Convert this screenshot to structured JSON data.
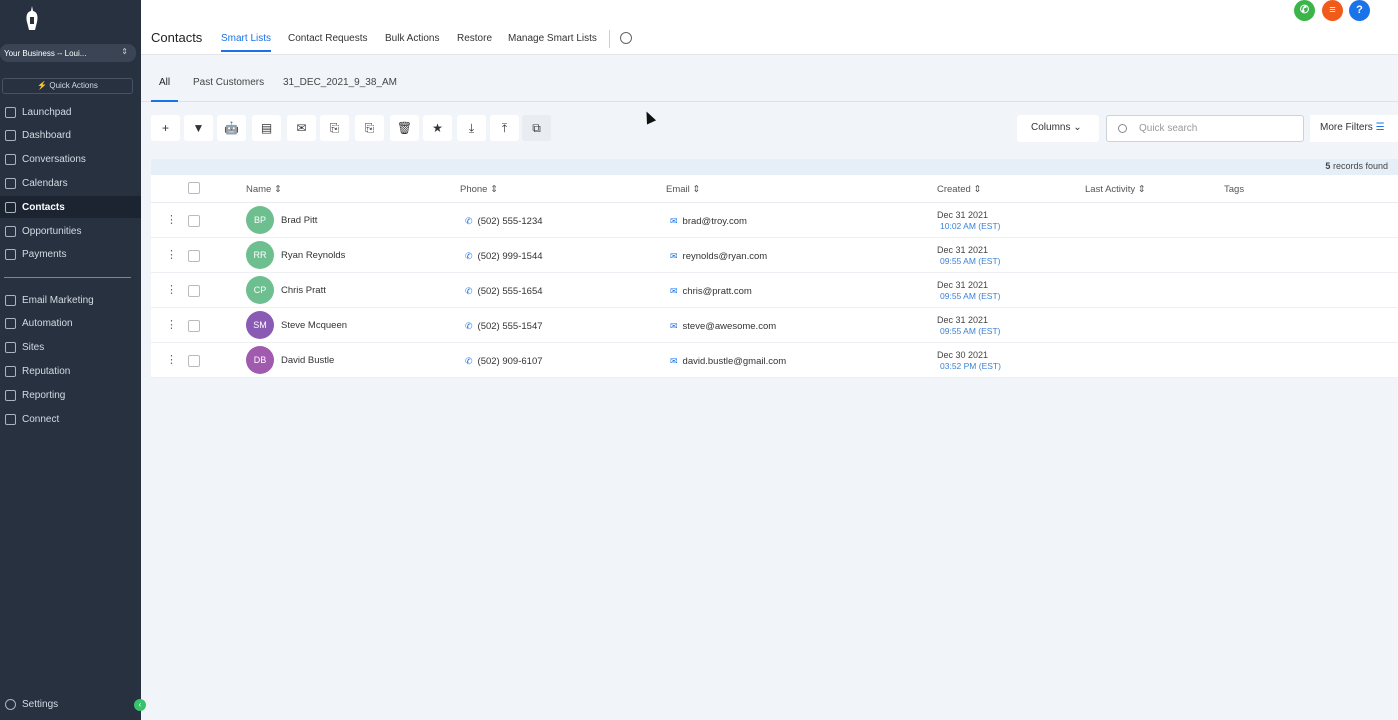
{
  "sidebar": {
    "business": "Your Business -- Loui...",
    "quick_actions": "Quick Actions",
    "items": [
      {
        "label": "Launchpad",
        "icon": "rocket-icon"
      },
      {
        "label": "Dashboard",
        "icon": "grid-icon"
      },
      {
        "label": "Conversations",
        "icon": "chat-icon"
      },
      {
        "label": "Calendars",
        "icon": "calendar-icon"
      },
      {
        "label": "Contacts",
        "icon": "contacts-icon",
        "active": true
      },
      {
        "label": "Opportunities",
        "icon": "funnel-icon"
      },
      {
        "label": "Payments",
        "icon": "payments-icon"
      }
    ],
    "items2": [
      {
        "label": "Email Marketing",
        "icon": "send-icon"
      },
      {
        "label": "Automation",
        "icon": "automation-icon"
      },
      {
        "label": "Sites",
        "icon": "sites-icon"
      },
      {
        "label": "Reputation",
        "icon": "star-icon"
      },
      {
        "label": "Reporting",
        "icon": "chart-icon"
      },
      {
        "label": "Connect",
        "icon": "facebook-icon"
      }
    ],
    "settings": "Settings"
  },
  "header": {
    "title": "Contacts",
    "tabs": [
      "Smart Lists",
      "Contact Requests",
      "Bulk Actions",
      "Restore",
      "Manage Smart Lists"
    ],
    "colors": {
      "phone": "#3bb54a",
      "list": "#f05a1a",
      "help": "#1a73e8"
    }
  },
  "subtabs": [
    "All",
    "Past Customers",
    "31_DEC_2021_9_38_AM"
  ],
  "toolbar": {
    "icons": [
      "plus-icon",
      "filter-icon",
      "robot-icon",
      "message-icon",
      "email-icon",
      "copy-add-icon",
      "copy-remove-icon",
      "trash-icon",
      "star-icon",
      "download-icon",
      "upload-icon",
      "merge-icon"
    ],
    "columns": "Columns",
    "search_placeholder": "Quick search",
    "more_filters": "More Filters"
  },
  "records": {
    "count": "5",
    "label": "records found"
  },
  "table": {
    "headers": [
      "Name",
      "Phone",
      "Email",
      "Created",
      "Last Activity",
      "Tags"
    ],
    "rows": [
      {
        "initials": "BP",
        "name": "Brad Pitt",
        "phone": "(502) 555-1234",
        "email": "brad@troy.com",
        "date": "Dec 31 2021",
        "time": "10:02 AM (EST)",
        "color": "#6dbf8f"
      },
      {
        "initials": "RR",
        "name": "Ryan Reynolds",
        "phone": "(502) 999-1544",
        "email": "reynolds@ryan.com",
        "date": "Dec 31 2021",
        "time": "09:55 AM (EST)",
        "color": "#6dbf8f"
      },
      {
        "initials": "CP",
        "name": "Chris Pratt",
        "phone": "(502) 555-1654",
        "email": "chris@pratt.com",
        "date": "Dec 31 2021",
        "time": "09:55 AM (EST)",
        "color": "#6dbf8f"
      },
      {
        "initials": "SM",
        "name": "Steve Mcqueen",
        "phone": "(502) 555-1547",
        "email": "steve@awesome.com",
        "date": "Dec 31 2021",
        "time": "09:55 AM (EST)",
        "color": "#8a5bb5"
      },
      {
        "initials": "DB",
        "name": "David Bustle",
        "phone": "(502) 909-6107",
        "email": "david.bustle@gmail.com",
        "date": "Dec 30 2021",
        "time": "03:52 PM (EST)",
        "color": "#a05aae"
      }
    ]
  }
}
